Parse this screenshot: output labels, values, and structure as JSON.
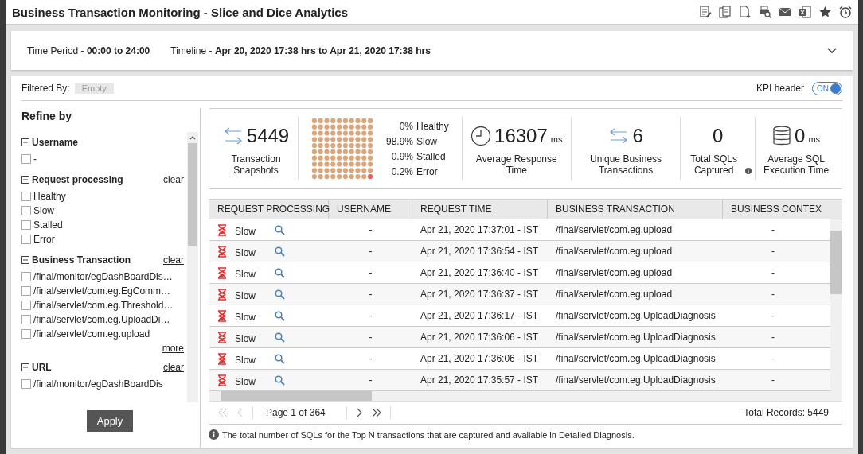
{
  "window": {
    "title": "Business Transaction Monitoring - Slice and Dice Analytics"
  },
  "time_bar": {
    "time_period_label": "Time Period - ",
    "time_period": "00:00 to 24:00",
    "timeline_label": "Timeline - ",
    "timeline": "Apr 20, 2020 17:38 hrs to Apr 21, 2020 17:38 hrs"
  },
  "filter_bar": {
    "label": "Filtered By:",
    "value": "Empty",
    "kpi_label": "KPI header",
    "kpi_toggle": {
      "label": "ON",
      "on": true
    }
  },
  "refine": {
    "title": "Refine by",
    "groups": [
      {
        "title": "Username",
        "items": [
          {
            "label": "-",
            "checked": false
          }
        ]
      },
      {
        "title": "Request processing",
        "clear": "clear",
        "items": [
          {
            "label": "Healthy",
            "checked": false
          },
          {
            "label": "Slow",
            "checked": false
          },
          {
            "label": "Stalled",
            "checked": false
          },
          {
            "label": "Error",
            "checked": false
          }
        ]
      },
      {
        "title": "Business Transaction",
        "clear": "clear",
        "more": "more",
        "items": [
          {
            "label": "/final/monitor/egDashBoardDis…",
            "checked": false
          },
          {
            "label": "/final/servlet/com.eg.EgComm…",
            "checked": false
          },
          {
            "label": "/final/servlet/com.eg.Threshold…",
            "checked": false
          },
          {
            "label": "/final/servlet/com.eg.UploadDi…",
            "checked": false
          },
          {
            "label": "/final/servlet/com.eg.upload",
            "checked": false
          }
        ]
      },
      {
        "title": "URL",
        "clear": "clear",
        "items": [
          {
            "label": "/final/monitor/egDashBoardDis",
            "checked": false
          }
        ]
      }
    ],
    "apply": "Apply"
  },
  "kpis": [
    {
      "kind": "count",
      "value": "5449",
      "label": "Transaction Snapshots"
    },
    {
      "kind": "health",
      "legend": [
        {
          "pct": "0%",
          "label": "Healthy"
        },
        {
          "pct": "98.9%",
          "label": "Slow"
        },
        {
          "pct": "0.9%",
          "label": "Stalled"
        },
        {
          "pct": "0.2%",
          "label": "Error"
        }
      ]
    },
    {
      "kind": "clock",
      "value": "16307",
      "unit": "ms",
      "label": "Average Response Time"
    },
    {
      "kind": "arrows",
      "value": "6",
      "label": "Unique Business Transactions"
    },
    {
      "kind": "plain",
      "value": "0",
      "label": "Total SQLs Captured",
      "info": true
    },
    {
      "kind": "database",
      "value": "0",
      "unit": "ms",
      "label": "Average SQL Execution Time"
    }
  ],
  "table": {
    "columns": [
      "REQUEST PROCESSING",
      "USERNAME",
      "REQUEST TIME",
      "BUSINESS TRANSACTION",
      "BUSINESS CONTEX"
    ],
    "rows": [
      {
        "status": "Slow",
        "username": "-",
        "time": "Apr 21, 2020 17:37:01 - IST",
        "transaction": "/final/servlet/com.eg.upload",
        "context": "-"
      },
      {
        "status": "Slow",
        "username": "-",
        "time": "Apr 21, 2020 17:36:54 - IST",
        "transaction": "/final/servlet/com.eg.upload",
        "context": "-"
      },
      {
        "status": "Slow",
        "username": "-",
        "time": "Apr 21, 2020 17:36:40 - IST",
        "transaction": "/final/servlet/com.eg.upload",
        "context": "-"
      },
      {
        "status": "Slow",
        "username": "-",
        "time": "Apr 21, 2020 17:36:37 - IST",
        "transaction": "/final/servlet/com.eg.upload",
        "context": "-"
      },
      {
        "status": "Slow",
        "username": "-",
        "time": "Apr 21, 2020 17:36:17 - IST",
        "transaction": "/final/servlet/com.eg.UploadDiagnosis",
        "context": "-"
      },
      {
        "status": "Slow",
        "username": "-",
        "time": "Apr 21, 2020 17:36:06 - IST",
        "transaction": "/final/servlet/com.eg.UploadDiagnosis",
        "context": "-"
      },
      {
        "status": "Slow",
        "username": "-",
        "time": "Apr 21, 2020 17:36:06 - IST",
        "transaction": "/final/servlet/com.eg.UploadDiagnosis",
        "context": "-"
      },
      {
        "status": "Slow",
        "username": "-",
        "time": "Apr 21, 2020 17:35:57 - IST",
        "transaction": "/final/servlet/com.eg.UploadDiagnosis",
        "context": "-"
      }
    ]
  },
  "pager": {
    "page": "Page 1 of 364",
    "total": "Total Records: 5449"
  },
  "footnote": "The total number of SQLs for the Top N transactions that are captured and available in Detailed Diagnosis."
}
